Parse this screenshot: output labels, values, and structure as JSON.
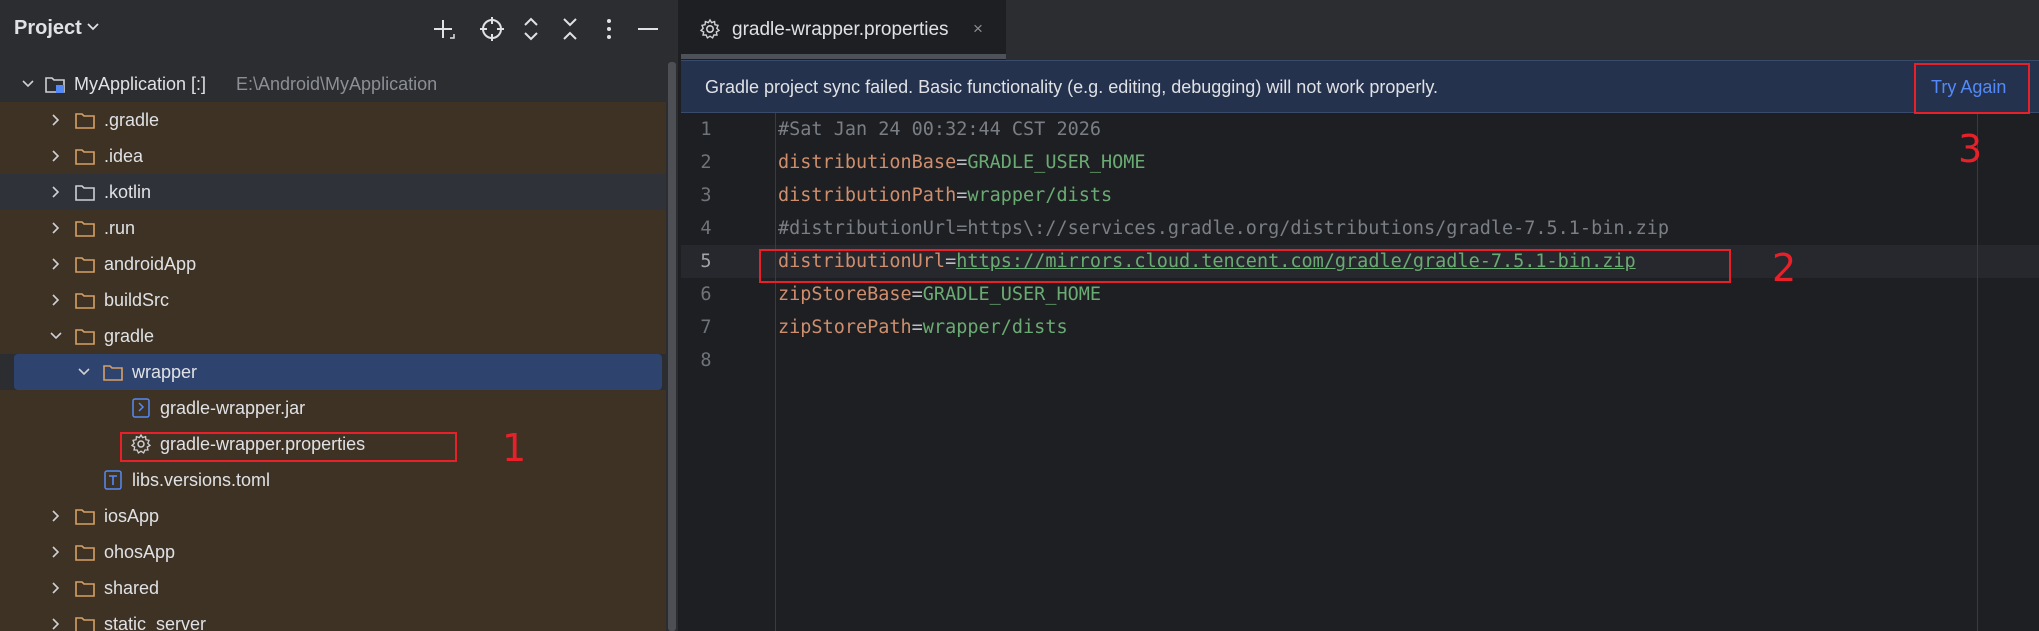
{
  "project_panel": {
    "title": "Project",
    "toolbar_icons": [
      "add-icon",
      "locate-icon",
      "expand-all-icon",
      "collapse-all-icon",
      "more-icon",
      "minimize-icon"
    ],
    "tree": [
      {
        "label": "MyApplication [:]",
        "path": "E:\\Android\\MyApplication",
        "type": "module",
        "depth": 0,
        "expanded": true
      },
      {
        "label": ".gradle",
        "type": "folder",
        "depth": 1,
        "expanded": false,
        "excluded": true
      },
      {
        "label": ".idea",
        "type": "folder",
        "depth": 1,
        "expanded": false,
        "excluded": true
      },
      {
        "label": ".kotlin",
        "type": "folder",
        "depth": 1,
        "expanded": false,
        "excluded": false
      },
      {
        "label": ".run",
        "type": "folder",
        "depth": 1,
        "expanded": false,
        "excluded": true
      },
      {
        "label": "androidApp",
        "type": "folder",
        "depth": 1,
        "expanded": false,
        "excluded": true
      },
      {
        "label": "buildSrc",
        "type": "folder",
        "depth": 1,
        "expanded": false,
        "excluded": true
      },
      {
        "label": "gradle",
        "type": "folder",
        "depth": 1,
        "expanded": true,
        "excluded": true
      },
      {
        "label": "wrapper",
        "type": "folder",
        "depth": 2,
        "expanded": true,
        "selected": true
      },
      {
        "label": "gradle-wrapper.jar",
        "type": "jar",
        "depth": 3,
        "excluded": true
      },
      {
        "label": "gradle-wrapper.properties",
        "type": "properties",
        "depth": 3,
        "excluded": true
      },
      {
        "label": "libs.versions.toml",
        "type": "toml",
        "depth": 2,
        "excluded": true
      },
      {
        "label": "iosApp",
        "type": "folder",
        "depth": 1,
        "expanded": false,
        "excluded": true
      },
      {
        "label": "ohosApp",
        "type": "folder",
        "depth": 1,
        "expanded": false,
        "excluded": true
      },
      {
        "label": "shared",
        "type": "folder",
        "depth": 1,
        "expanded": false,
        "excluded": true
      },
      {
        "label": "static_server",
        "type": "folder",
        "depth": 1,
        "expanded": false,
        "excluded": true
      }
    ]
  },
  "editor": {
    "tab": {
      "label": "gradle-wrapper.properties",
      "icon": "gear-icon",
      "close": "×"
    },
    "banner": {
      "message": "Gradle project sync failed. Basic functionality (e.g. editing, debugging) will not work properly.",
      "action": "Try Again"
    },
    "current_line": 5,
    "lines": [
      {
        "num": "1",
        "kind": "comment",
        "text": "#Sat Jan 24 00:32:44 CST 2026"
      },
      {
        "num": "2",
        "kind": "prop",
        "key": "distributionBase",
        "value": "GRADLE_USER_HOME"
      },
      {
        "num": "3",
        "kind": "prop",
        "key": "distributionPath",
        "value": "wrapper/dists"
      },
      {
        "num": "4",
        "kind": "comment",
        "text": "#distributionUrl=https\\://services.gradle.org/distributions/gradle-7.5.1-bin.zip"
      },
      {
        "num": "5",
        "kind": "url",
        "key": "distributionUrl",
        "value": "https://mirrors.cloud.tencent.com/gradle/gradle-7.5.1-bin.zip"
      },
      {
        "num": "6",
        "kind": "prop",
        "key": "zipStoreBase",
        "value": "GRADLE_USER_HOME"
      },
      {
        "num": "7",
        "kind": "prop",
        "key": "zipStorePath",
        "value": "wrapper/dists"
      },
      {
        "num": "8",
        "kind": "empty",
        "text": ""
      }
    ]
  },
  "annotations": [
    {
      "num": "1",
      "target": "gradle-wrapper.properties file in tree",
      "color": "#e8202a"
    },
    {
      "num": "2",
      "target": "distributionUrl line",
      "color": "#e8202a"
    },
    {
      "num": "3",
      "target": "Try Again link",
      "color": "#e8202a"
    }
  ]
}
